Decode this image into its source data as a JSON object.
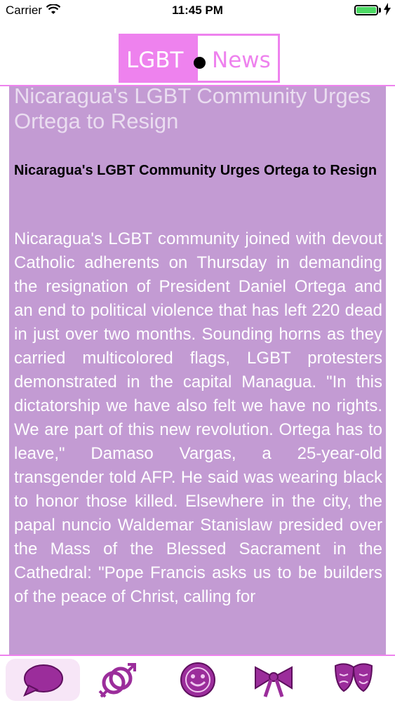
{
  "status_bar": {
    "carrier": "Carrier",
    "time": "11:45 PM",
    "battery_color": "#4cd964"
  },
  "header": {
    "logo_left": "LGBT",
    "logo_right": "News",
    "accent_color": "#ee82ee"
  },
  "article": {
    "title": "Nicaragua's LGBT Community Urges Ortega to Resign",
    "subtitle": "Nicaragua's LGBT Community Urges Ortega to Resign",
    "body": "Nicaragua's LGBT community joined with devout Catholic adherents on Thursday in demanding the resignation of President Daniel Ortega and an end to political violence that has left 220 dead in just over two months. Sounding horns as they carried multicolored flags, LGBT protesters demonstrated in the capital Managua. \"In this dictatorship we have also felt we have no rights. We are part of this new revolution. Ortega has to leave,\" Damaso Vargas, a 25-year-old transgender told AFP. He said was wearing black to honor those killed. Elsewhere in the city, the papal nuncio Waldemar Stanislaw presided over the Mass of the Blessed Sacrament in the Cathedral: \"Pope Francis asks us to be builders of the peace of Christ, calling for",
    "background_color": "#c39bd3"
  },
  "tab_bar": {
    "tabs": [
      {
        "icon": "speech-bubble-icon",
        "selected": true
      },
      {
        "icon": "gender-symbols-icon",
        "selected": false
      },
      {
        "icon": "smiley-face-icon",
        "selected": false
      },
      {
        "icon": "bow-ribbon-icon",
        "selected": false
      },
      {
        "icon": "theater-masks-icon",
        "selected": false
      }
    ],
    "icon_color": "#9b2d9b"
  }
}
